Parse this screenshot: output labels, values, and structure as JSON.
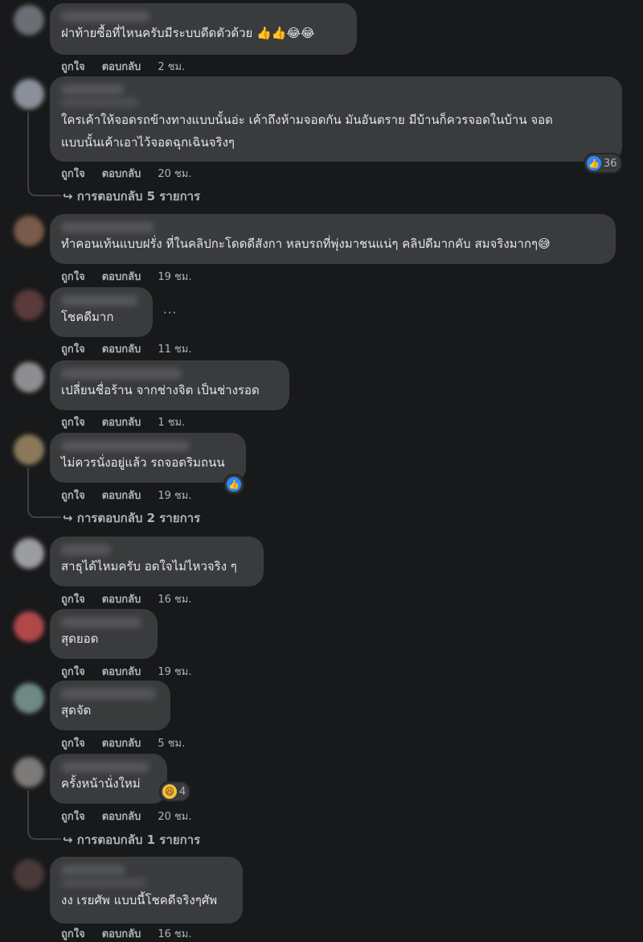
{
  "comments": [
    {
      "text": "ฝาท้ายซื้อที่ไหนครับมีระบบดีดตัวด้วย 👍👍😂😂",
      "like": "ถูกใจ",
      "reply": "ตอบกลับ",
      "time": "2 ชม."
    },
    {
      "text": "ใครเค้าให้จอดรถข้างทางแบบนั้นอ่ะ เค้าถึงห้ามจอดกัน มันอันตราย มีบ้านก็ควรจอดในบ้าน จอด\nแบบนั้นเค้าเอาไว้จอดฉุกเฉินจริงๆ",
      "like": "ถูกใจ",
      "reply": "ตอบกลับ",
      "time": "20 ชม.",
      "reaction_count": "36",
      "replies": "↪ การตอบกลับ 5 รายการ"
    },
    {
      "text": "ทำคอนเท้นแบบฝรั่ง ที่ในคลิปกะโดดดีสังกา หลบรถที่พุ่งมาชนแน่ๆ คลิปดีมากคับ สมจริงมากๆ😅",
      "like": "ถูกใจ",
      "reply": "ตอบกลับ",
      "time": "19 ชม."
    },
    {
      "text": "โชคดีมาก",
      "like": "ถูกใจ",
      "reply": "ตอบกลับ",
      "time": "11 ชม.",
      "more": "···"
    },
    {
      "text": "เปลี่ยนชื่อร้าน จากช่างจิต เป็นช่างรอด",
      "like": "ถูกใจ",
      "reply": "ตอบกลับ",
      "time": "1 ชม."
    },
    {
      "text": "ไม่ควรนั่งอยู่แล้ว รถจอดริมถนน",
      "like": "ถูกใจ",
      "reply": "ตอบกลับ",
      "time": "19 ชม.",
      "replies": "↪ การตอบกลับ 2 รายการ"
    },
    {
      "text": "สาธุได้ไหมครับ อดใจไม่ไหวจริง ๆ",
      "like": "ถูกใจ",
      "reply": "ตอบกลับ",
      "time": "16 ชม."
    },
    {
      "text": "สุดยอด",
      "like": "ถูกใจ",
      "reply": "ตอบกลับ",
      "time": "19 ชม."
    },
    {
      "text": "สุดจัด",
      "like": "ถูกใจ",
      "reply": "ตอบกลับ",
      "time": "5 ชม."
    },
    {
      "text": "ครั้งหน้านั่งใหม่",
      "like": "ถูกใจ",
      "reply": "ตอบกลับ",
      "time": "20 ชม.",
      "reaction_count": "4",
      "replies": "↪ การตอบกลับ 1 รายการ"
    },
    {
      "text": "งง เรยศัพ แบบนี้โชคดีจริงๆศัพ",
      "like": "ถูกใจ",
      "reply": "ตอบกลับ",
      "time": "16 ชม."
    }
  ],
  "colors": {
    "background": "#18191a",
    "bubble": "#3a3b3c",
    "secondary_text": "#b0b3b8",
    "like_blue": "#2d88ff"
  },
  "icons": {
    "like": "thumbs-up-icon",
    "haha": "haha-emoji-icon",
    "more": "more-options-icon"
  }
}
